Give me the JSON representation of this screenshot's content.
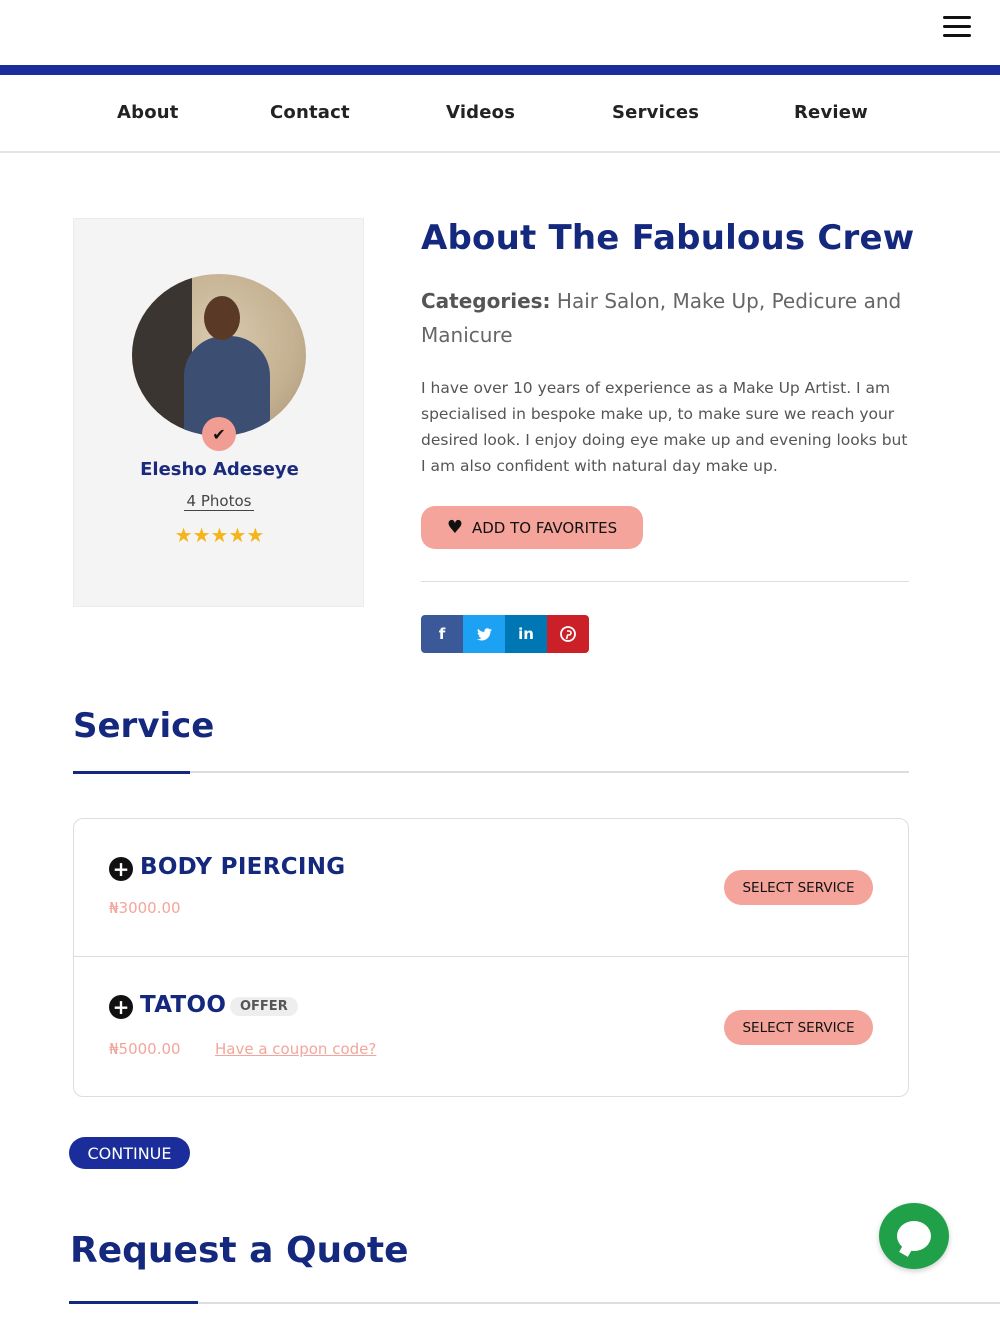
{
  "nav": {
    "items": [
      {
        "label": "About"
      },
      {
        "label": "Contact"
      },
      {
        "label": "Videos"
      },
      {
        "label": "Services"
      },
      {
        "label": "Review"
      }
    ]
  },
  "profile": {
    "name": "Elesho Adeseye",
    "photos": "4 Photos",
    "stars": "★★★★★",
    "rating": 5,
    "verified_icon": "check-icon"
  },
  "about": {
    "title": "About The Fabulous Crew",
    "categories_label": "Categories:",
    "categories_value": " Hair Salon, Make Up, Pedicure and Manicure",
    "description": "I have over 10 years of experience as a Make Up Artist. I am specialised in bespoke make up, to make sure we reach your desired look. I enjoy doing eye make up and evening looks but I am also confident with natural day make up.",
    "favorite_button": "ADD TO FAVORITES"
  },
  "social": [
    {
      "icon": "facebook-icon",
      "glyph": "f",
      "color": "#3b5998"
    },
    {
      "icon": "twitter-icon",
      "glyph": "🐦",
      "color": "#1da1f2"
    },
    {
      "icon": "linkedin-icon",
      "glyph": "in",
      "color": "#0077b5"
    },
    {
      "icon": "pinterest-icon",
      "glyph": "℗",
      "color": "#cb2027"
    }
  ],
  "service_section": {
    "title": "Service",
    "items": [
      {
        "name": "BODY PIERCING",
        "price": "₦3000.00",
        "button": "SELECT SERVICE"
      },
      {
        "name": "TATOO",
        "badge": "OFFER",
        "price": "₦5000.00",
        "coupon": "Have a coupon code?",
        "button": "SELECT SERVICE"
      }
    ],
    "continue": "CONTINUE"
  },
  "quote": {
    "title": "Request a Quote"
  },
  "colors": {
    "primary": "#14287e",
    "accent_pink": "#f4a49a",
    "chat_green": "#21a04a"
  }
}
